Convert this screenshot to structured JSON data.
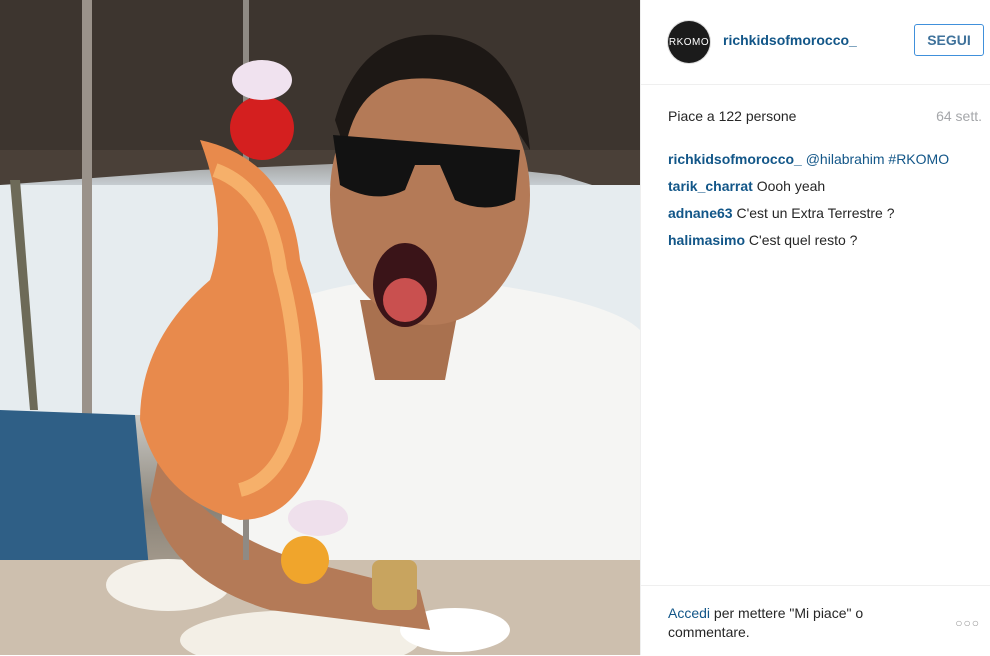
{
  "post": {
    "username": "richkidsofmorocco_",
    "avatar_text": "RKOMO",
    "follow_label": "SEGUI",
    "likes_text": "Piace a 122 persone",
    "age_text": "64 sett.",
    "comments": [
      {
        "user": "richkidsofmorocco_",
        "text": "@hilabrahim #RKOMO",
        "tags": true
      },
      {
        "user": "tarik_charrat",
        "text": "Oooh yeah",
        "tags": false
      },
      {
        "user": "adnane63",
        "text": "C'est un Extra Terrestre ?",
        "tags": false
      },
      {
        "user": "halimasimo",
        "text": "C'est quel resto ?",
        "tags": false
      }
    ],
    "login_link": "Accedi",
    "login_text": " per mettere \"Mi piace\" o commentare.",
    "more_icon": "ellipsis-icon"
  },
  "colors": {
    "link": "#125688",
    "follow_border": "#4090db",
    "muted": "#a5a7aa"
  }
}
